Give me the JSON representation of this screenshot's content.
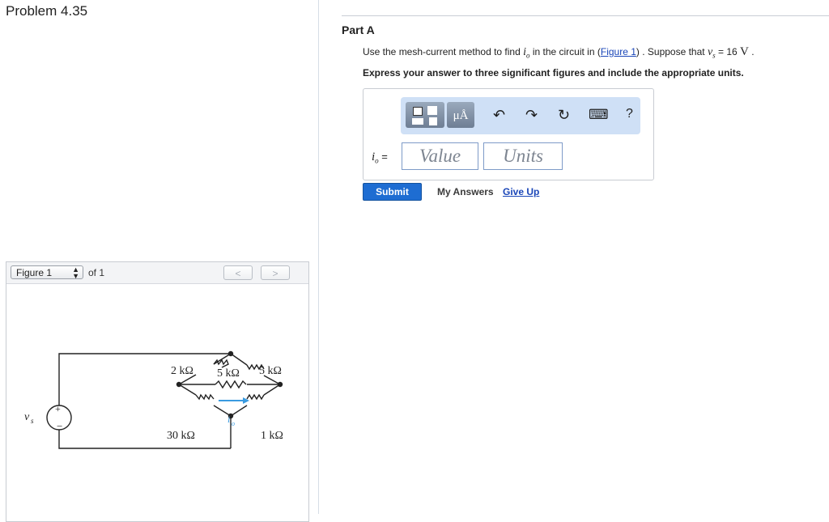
{
  "problem": {
    "title": "Problem 4.35"
  },
  "figure_panel": {
    "selected_figure": "Figure 1",
    "of_label": "of 1",
    "prev_label": "<",
    "next_label": ">"
  },
  "circuit": {
    "source_label": "v",
    "source_subscript": "s",
    "plus": "+",
    "minus": "−",
    "r_2k": "2 kΩ",
    "r_5k_top": "5 kΩ",
    "r_5k_mid": "5 kΩ",
    "r_30k": "30 kΩ",
    "r_1k": "1 kΩ",
    "current_label": "i",
    "current_subscript": "o"
  },
  "part": {
    "label": "Part A",
    "question": {
      "pre": "Use the mesh-current method to find ",
      "var": "i",
      "var_sub": "o",
      "mid": " in the circuit in (",
      "link": "Figure 1",
      "post": ") . Suppose that ",
      "vs_var": "v",
      "vs_sub": "s",
      "eq": " = 16 ",
      "unit": "V",
      "end": " ."
    },
    "instruction": "Express your answer to three significant figures and include the appropriate units."
  },
  "answer": {
    "toolbar": {
      "mu_label": "μÅ",
      "undo_icon": "↶",
      "redo_icon": "↷",
      "reset_icon": "↻",
      "keyboard_icon": "⌨",
      "help_label": "?"
    },
    "io_var": "i",
    "io_sub": "o",
    "io_eq": " =",
    "value_placeholder": "Value",
    "units_placeholder": "Units"
  },
  "actions": {
    "submit": "Submit",
    "my_answers": "My Answers",
    "give_up": "Give Up"
  }
}
